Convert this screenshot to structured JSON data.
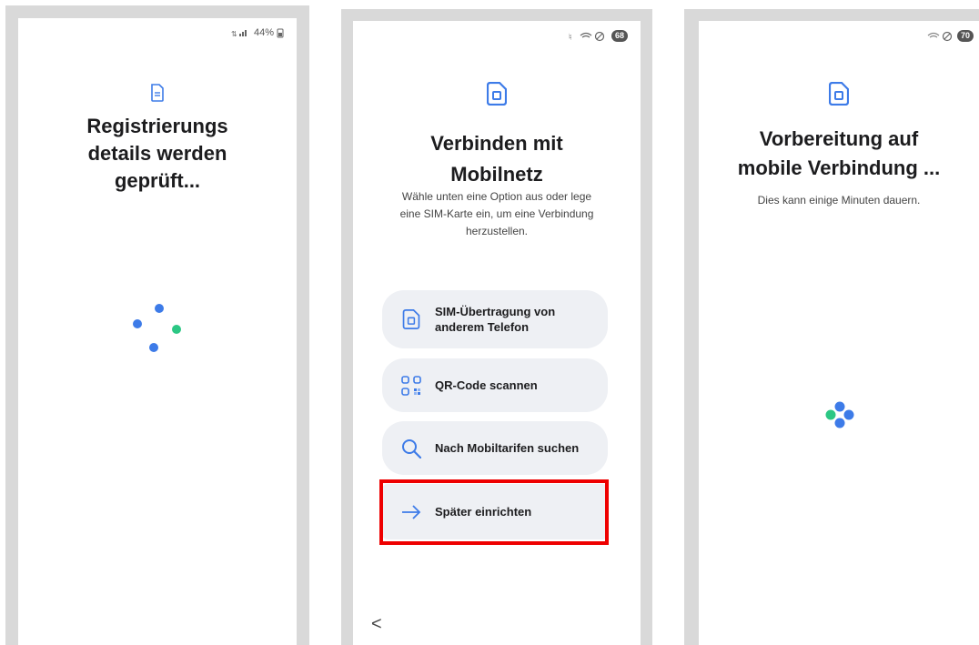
{
  "screen1": {
    "status": "44%",
    "title_line1": "Registrierungs",
    "title_line2": "details werden",
    "title_line3": "geprüft...",
    "icon": "document-icon",
    "loader": "loading-dots"
  },
  "screen2": {
    "status_badge": "68",
    "icon": "sim-card-icon",
    "title_line1": "Verbinden mit",
    "title_line2": "Mobilnetz",
    "subtitle_line1": "Wähle unten eine Option aus oder lege",
    "subtitle_line2": "eine SIM-Karte ein, um eine Verbindung",
    "subtitle_line3": "herzustellen.",
    "options": [
      {
        "line1": "SIM-Übertragung von",
        "line2": "anderem Telefon",
        "icon": "sim-card-icon"
      },
      {
        "line1": "QR-Code scannen",
        "icon": "qr-code-icon"
      },
      {
        "line1": "Nach Mobiltarifen suchen",
        "icon": "search-icon"
      },
      {
        "line1": "Später einrichten",
        "icon": "arrow-right-icon"
      }
    ],
    "back": "<"
  },
  "screen3": {
    "status_badge": "70",
    "icon": "sim-card-icon",
    "title_line1": "Vorbereitung auf",
    "title_line2": "mobile Verbindung ...",
    "subtitle": "Dies kann einige Minuten dauern.",
    "loader": "loading-dots"
  },
  "colors": {
    "accent": "#3d7be8",
    "green": "#2cc784",
    "highlight": "#ee0000",
    "option_bg": "#eef0f4"
  }
}
